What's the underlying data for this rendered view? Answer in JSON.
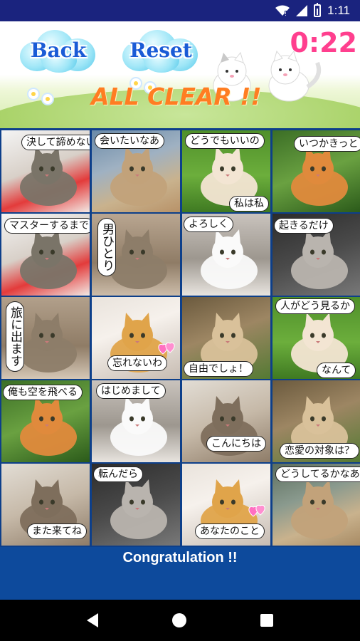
{
  "status_bar": {
    "time": "1:11",
    "icons": [
      "wifi-icon",
      "signal-icon",
      "battery-icon"
    ]
  },
  "header": {
    "back_label": "Back",
    "reset_label": "Reset",
    "timer": "0:22",
    "message": "ALL CLEAR !!"
  },
  "tiles": [
    {
      "caption": "決して諦めない",
      "photo": "cat lying on a red cushion"
    },
    {
      "caption": "会いたいなあ",
      "photo": "fluffy long-haired cat"
    },
    {
      "caption": "どうでもいいの",
      "caption2": "私は私",
      "photo": "orange and white cat in grass"
    },
    {
      "caption": "いつかきっと",
      "photo": "orange cat looking up"
    },
    {
      "caption": "マスターするまで",
      "photo": "cat lying on a red cushion"
    },
    {
      "caption": "男ひとり",
      "photo": "tabby kitten walking"
    },
    {
      "caption": "よろしく",
      "photo": "two black and white cats"
    },
    {
      "caption": "起きるだけ",
      "photo": "grey tabby cat lying on back"
    },
    {
      "caption": "旅に出ます",
      "photo": "tabby kitten walking"
    },
    {
      "caption": "忘れないわ",
      "photo": "calico cat sleeping"
    },
    {
      "caption": "自由でしょ！",
      "photo": "cats sleeping on grass"
    },
    {
      "caption": "人がどう見るか",
      "caption2": "なんて",
      "photo": "orange and white cat in grass"
    },
    {
      "caption": "俺も空を飛べる",
      "photo": "orange cat looking up"
    },
    {
      "caption": "はじめまして",
      "photo": "two black and white cats"
    },
    {
      "caption": "こんにちは",
      "photo": "tabby and white cat"
    },
    {
      "caption": "恋愛の対象は？",
      "photo": "cats sleeping on grass"
    },
    {
      "caption": "また来てね",
      "photo": "tabby and white cat"
    },
    {
      "caption": "転んだら",
      "photo": "grey tabby cat lying on back"
    },
    {
      "caption": "あなたのこと",
      "photo": "calico cat sleeping"
    },
    {
      "caption": "どうしてるかなあ？",
      "photo": "fluffy long-haired cat"
    }
  ],
  "footer": {
    "message": "Congratulation !!"
  },
  "nav": {
    "icons": [
      "nav-back-icon",
      "nav-home-icon",
      "nav-recent-icon"
    ]
  }
}
